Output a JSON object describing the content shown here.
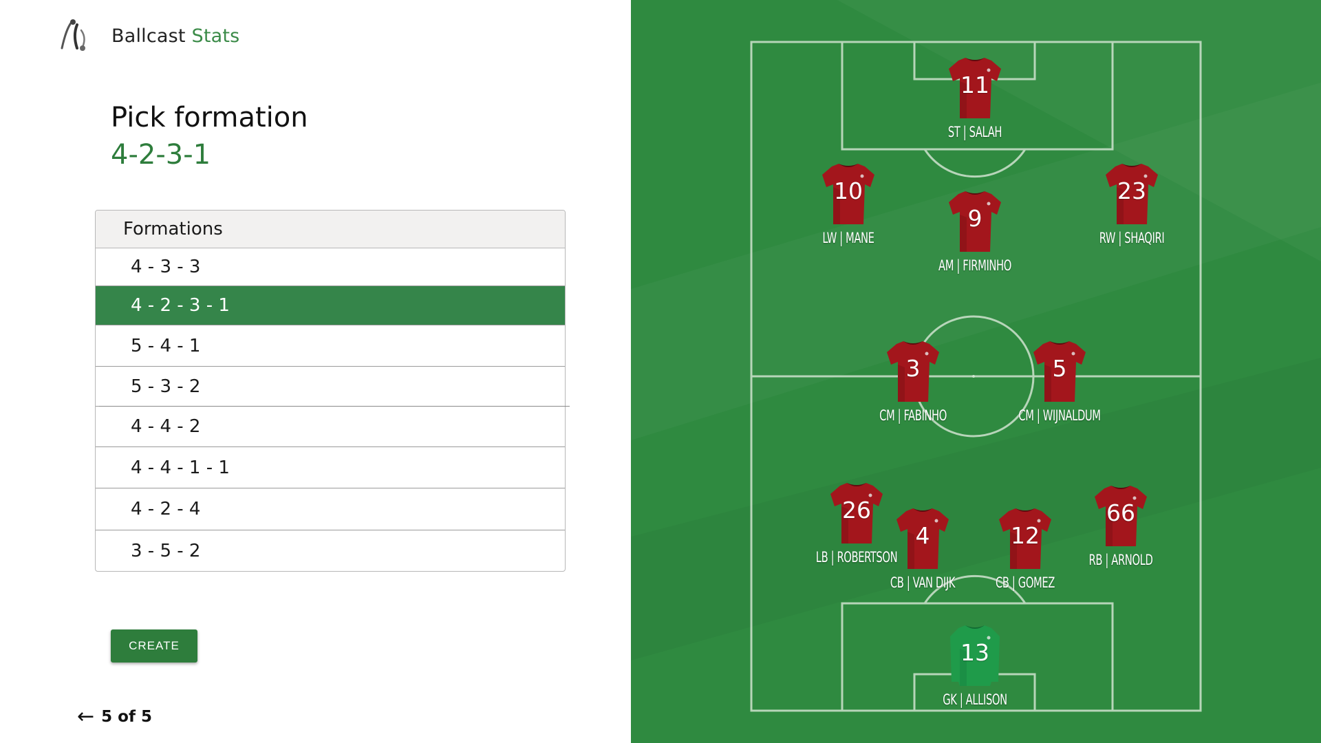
{
  "brand": {
    "name_part1": "Ballcast",
    "name_part2": "Stats",
    "accent": "#3b8b48"
  },
  "heading": {
    "title": "Pick formation",
    "selected_formation": "4-2-3-1"
  },
  "formations_table": {
    "header": "Formations",
    "rows": [
      {
        "label": "4 - 3 - 3",
        "selected": false
      },
      {
        "label": "4 - 2 - 3 - 1",
        "selected": true
      },
      {
        "label": "5 - 4 - 1",
        "selected": false
      },
      {
        "label": "5 - 3 - 2",
        "selected": false
      },
      {
        "label": "4 - 4 - 2",
        "selected": false
      },
      {
        "label": "4 - 4 - 1 - 1",
        "selected": false
      },
      {
        "label": "4 - 2 - 4",
        "selected": false
      },
      {
        "label": "3 - 5 - 2",
        "selected": false
      }
    ],
    "selected_color": "#35854a"
  },
  "create_button": {
    "label": "CREATE",
    "color": "#2e7d3c"
  },
  "pager": {
    "arrow_icon": "arrow-left-icon",
    "text": "5 of 5"
  },
  "pitch": {
    "grass_color": "#2f8a40",
    "players": [
      {
        "number": "11",
        "label": "ST | SALAH",
        "kit": "red"
      },
      {
        "number": "10",
        "label": "LW | MANE",
        "kit": "red"
      },
      {
        "number": "9",
        "label": "AM | FIRMINHO",
        "kit": "red"
      },
      {
        "number": "23",
        "label": "RW | SHAQIRI",
        "kit": "red"
      },
      {
        "number": "3",
        "label": "CM | FABINHO",
        "kit": "red"
      },
      {
        "number": "5",
        "label": "CM | WIJNALDUM",
        "kit": "red"
      },
      {
        "number": "26",
        "label": "LB | ROBERTSON",
        "kit": "red"
      },
      {
        "number": "4",
        "label": "CB | VAN DIJK",
        "kit": "red"
      },
      {
        "number": "12",
        "label": "CB | GOMEZ",
        "kit": "red"
      },
      {
        "number": "66",
        "label": "RB | ARNOLD",
        "kit": "red"
      },
      {
        "number": "13",
        "label": "GK | ALLISON",
        "kit": "green"
      }
    ]
  }
}
